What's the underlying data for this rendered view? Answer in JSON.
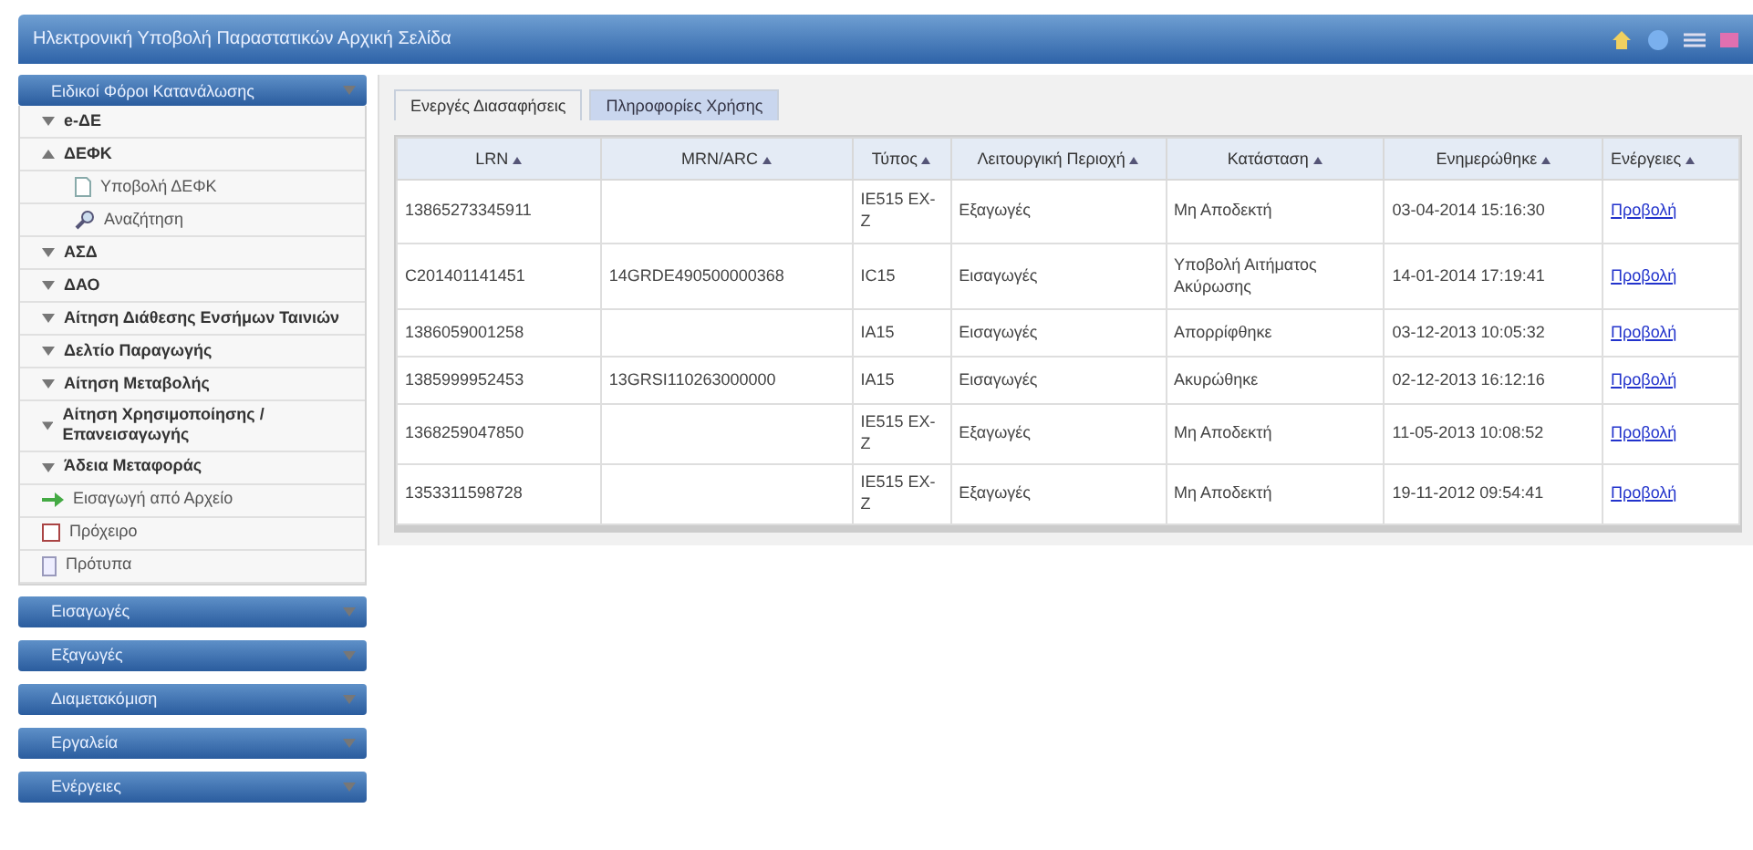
{
  "window": {
    "title": "Ηλεκτρονική Υποβολή Παραστατικών Αρχική Σελίδα"
  },
  "sidebar": {
    "title": "Ειδικοί Φόροι Κατανάλωσης",
    "items": [
      {
        "label": "e-ΔΕ",
        "kind": "group",
        "expanded": false
      },
      {
        "label": "ΔΕΦΚ",
        "kind": "group",
        "expanded": true,
        "children": [
          {
            "label": "Υποβολή ΔΕΦΚ",
            "kind": "document"
          },
          {
            "label": "Αναζήτηση",
            "kind": "search"
          }
        ]
      },
      {
        "label": "ΑΣΔ",
        "kind": "group",
        "expanded": false
      },
      {
        "label": "ΔΑΟ",
        "kind": "group",
        "expanded": false
      },
      {
        "label": "Αίτηση Διάθεσης Ενσήμων Ταινιών",
        "kind": "group",
        "expanded": false
      },
      {
        "label": "Δελτίο Παραγωγής",
        "kind": "group",
        "expanded": false
      },
      {
        "label": "Αίτηση Μεταβολής",
        "kind": "group",
        "expanded": false
      },
      {
        "label": "Αίτηση Χρησιμοποίησης / Επανεισαγωγής",
        "kind": "group",
        "expanded": false
      },
      {
        "label": "Άδεια Μεταφοράς",
        "kind": "group",
        "expanded": false
      },
      {
        "label": "Εισαγωγή από Αρχείο",
        "kind": "import"
      },
      {
        "label": "Πρόχειρο",
        "kind": "draft"
      },
      {
        "label": "Πρότυπα",
        "kind": "template"
      }
    ],
    "sections": [
      "Εισαγωγές",
      "Εξαγωγές",
      "Διαμετακόμιση",
      "Εργαλεία",
      "Ενέργειες"
    ]
  },
  "tabs": [
    {
      "label": "Ενεργές Διασαφήσεις",
      "selected": true
    },
    {
      "label": "Πληροφορίες Χρήσης",
      "selected": false
    }
  ],
  "table": {
    "columns": [
      "LRN",
      "MRN/ARC",
      "Τύπος",
      "Λειτουργική Περιοχή",
      "Κατάσταση",
      "Ενημερώθηκε",
      "Ενέργειες"
    ],
    "rows": [
      [
        "13865273345911",
        "",
        "IE515 EX-Z",
        "Εξαγωγές",
        "Μη Αποδεκτή",
        "03-04-2014 15:16:30",
        "Προβολή"
      ],
      [
        "C201401141451",
        "14GRDE490500000368",
        "IC15",
        "Εισαγωγές",
        "Υποβολή Αιτήματος Ακύρωσης",
        "14-01-2014 17:19:41",
        "Προβολή"
      ],
      [
        "1386059001258",
        "",
        "IA15",
        "Εισαγωγές",
        "Απορρίφθηκε",
        "03-12-2013 10:05:32",
        "Προβολή"
      ],
      [
        "1385999952453",
        "13GRSI110263000000",
        "IA15",
        "Εισαγωγές",
        "Ακυρώθηκε",
        "02-12-2013 16:12:16",
        "Προβολή"
      ],
      [
        "1368259047850",
        "",
        "IE515 EX-Z",
        "Εξαγωγές",
        "Μη Αποδεκτή",
        "11-05-2013 10:08:52",
        "Προβολή"
      ],
      [
        "1353311598728",
        "",
        "IE515 EX-Z",
        "Εξαγωγές",
        "Μη Αποδεκτή",
        "19-11-2012 09:54:41",
        "Προβολή"
      ]
    ]
  }
}
